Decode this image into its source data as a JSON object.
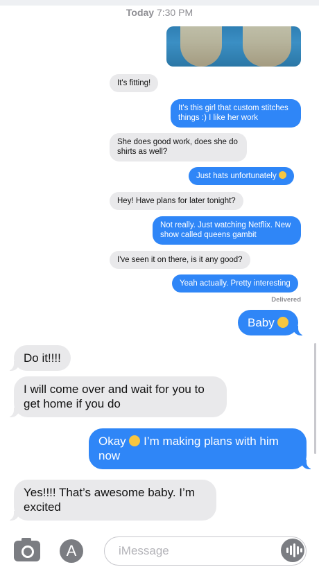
{
  "header": {
    "day": "Today",
    "time": "7:30 PM"
  },
  "inner_thread": [
    {
      "from": "them",
      "text": "It's fitting!"
    },
    {
      "from": "me",
      "text": "It's this girl that custom stitches things :) I like her work"
    },
    {
      "from": "them",
      "text": "She does good work, does she do shirts as well?"
    },
    {
      "from": "me",
      "text": "Just hats unfortunately",
      "emoji": "grimacing-face-icon"
    },
    {
      "from": "them",
      "text": "Hey! Have plans for later tonight?"
    },
    {
      "from": "me",
      "text": "Not really. Just watching Netflix. New show called queens gambit"
    },
    {
      "from": "them",
      "text": "I've seen it on there, is it any good?"
    },
    {
      "from": "me",
      "text": "Yeah actually. Pretty interesting"
    }
  ],
  "inner_status": "Delivered",
  "thread": [
    {
      "from": "me",
      "text": "Baby",
      "emoji": "flushed-face-icon"
    },
    {
      "from": "them",
      "text": "Do it!!!!"
    },
    {
      "from": "them",
      "text": "I will come over and wait for you to get home if you do"
    },
    {
      "from": "me",
      "text_before": "Okay",
      "emoji": "relieved-face-icon",
      "text_after": "I’m making plans with him now"
    },
    {
      "from": "them",
      "text": "Yes!!!! That’s awesome baby. I’m excited"
    }
  ],
  "composer": {
    "placeholder": "iMessage",
    "value": ""
  },
  "colors": {
    "outgoing": "#2f86f7",
    "incoming": "#e9e9eb",
    "meta": "#8e8e93"
  }
}
